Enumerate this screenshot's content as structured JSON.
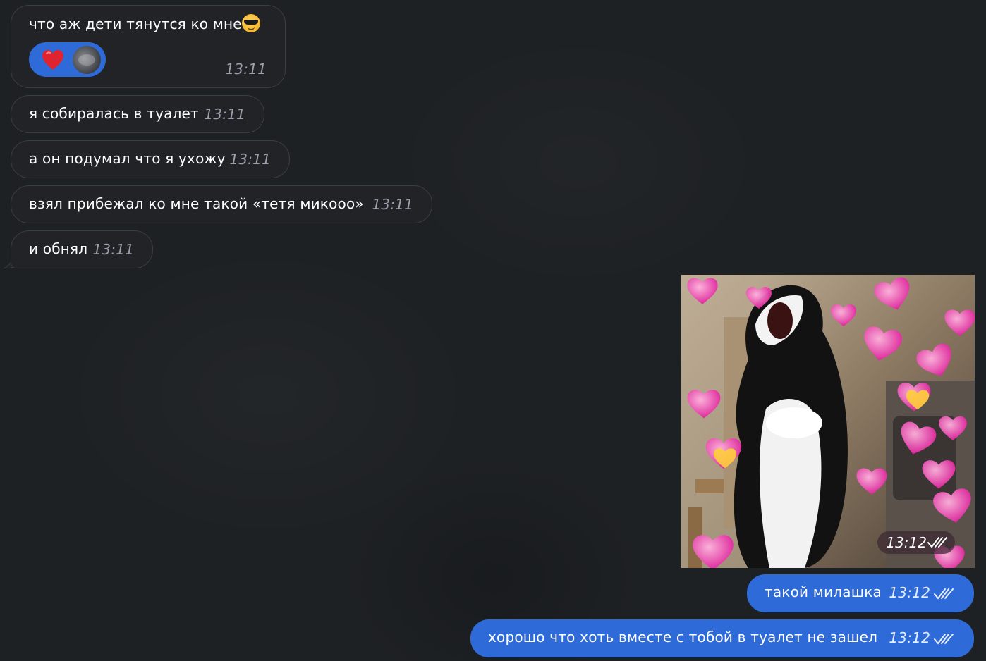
{
  "messages_in": [
    {
      "text": "что аж дети тянутся ко мне",
      "time": "13:11",
      "emoji": "smiling-face-with-sunglasses"
    },
    {
      "text": "я собиралась в туалет",
      "time": "13:11"
    },
    {
      "text": "а он подумал что я ухожу",
      "time": "13:11"
    },
    {
      "text": "взял прибежал ко мне такой «тетя микооо»",
      "time": "13:11"
    },
    {
      "text": "и обнял",
      "time": "13:11"
    }
  ],
  "reaction": {
    "emoji": "red-heart",
    "avatar": "cat-avatar"
  },
  "photo_message": {
    "time": "13:12",
    "status": "read"
  },
  "messages_out": [
    {
      "text": "такой милашка",
      "time": "13:12",
      "status": "read"
    },
    {
      "text": "хорошо что хоть вместе с тобой в туалет не зашел",
      "time": "13:12",
      "status": "read"
    }
  ],
  "colors": {
    "background": "#1e2124",
    "incoming_bubble": "#212327",
    "outgoing_bubble": "#2f6bd8",
    "heart": "#e0242f"
  }
}
